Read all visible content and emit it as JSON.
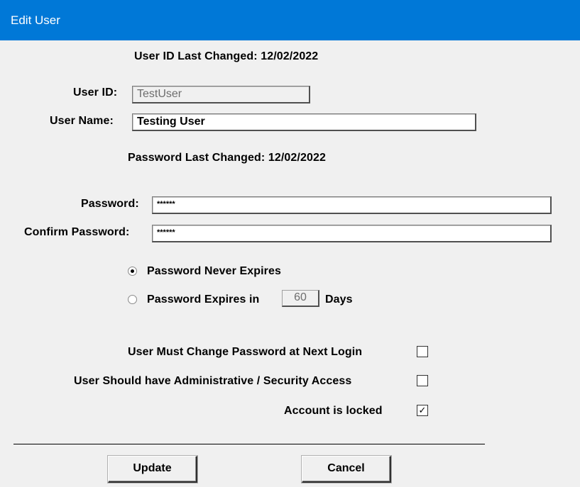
{
  "window": {
    "title": "Edit User"
  },
  "form": {
    "user_id_last_changed": "User ID Last Changed: 12/02/2022",
    "user_id_label": "User ID:",
    "user_id_value": "TestUser",
    "user_name_label": "User Name:",
    "user_name_value": "Testing User",
    "password_last_changed": "Password Last Changed: 12/02/2022",
    "password_label": "Password:",
    "password_value": "******",
    "confirm_password_label": "Confirm Password:",
    "confirm_password_value": "******",
    "radio_never_expires": "Password Never Expires",
    "radio_expires_in": "Password Expires in",
    "expire_days_value": "60",
    "days_label": "Days",
    "selected_expiry_option": "never_expires",
    "must_change_label": "User Must Change Password at Next Login",
    "must_change_checked": false,
    "admin_access_label": "User Should have Administrative / Security Access",
    "admin_access_checked": false,
    "locked_label": "Account is locked",
    "locked_checked": true
  },
  "buttons": {
    "update": "Update",
    "cancel": "Cancel"
  },
  "colors": {
    "titlebar": "#0078d7",
    "background": "#f0f0f0"
  }
}
